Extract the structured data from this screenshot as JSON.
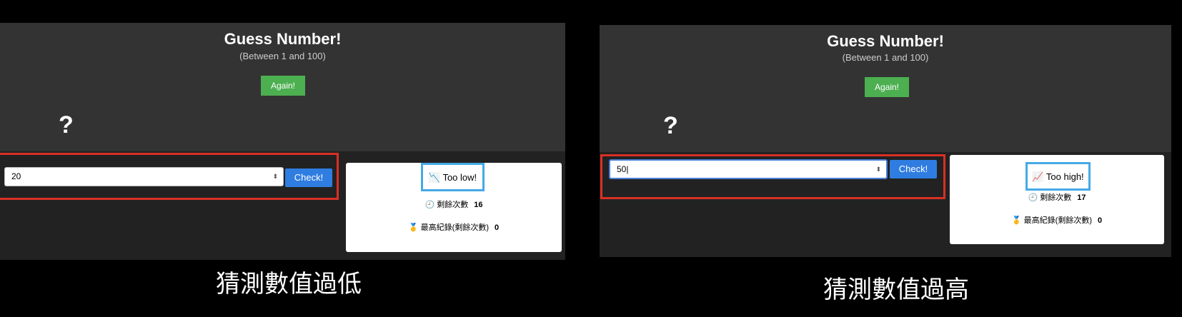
{
  "screens": [
    {
      "title": "Guess Number!",
      "subtitle": "(Between 1 and 100)",
      "again_label": "Again!",
      "mystery": "?",
      "input_value": "20",
      "check_label": "Check!",
      "feedback_icon": "📉",
      "feedback_text": "Too low!",
      "remaining_icon": "🕘",
      "remaining_label": "剩餘次數",
      "remaining_value": "16",
      "record_icon": "🥇",
      "record_label": "最高紀錄(剩餘次數)",
      "record_value": "0",
      "caption": "猜測數值過低"
    },
    {
      "title": "Guess Number!",
      "subtitle": "(Between 1 and 100)",
      "again_label": "Again!",
      "mystery": "?",
      "input_value": "50",
      "check_label": "Check!",
      "feedback_icon": "📈",
      "feedback_text": "Too high!",
      "remaining_icon": "🕘",
      "remaining_label": "剩餘次數",
      "remaining_value": "17",
      "record_icon": "🥇",
      "record_label": "最高紀錄(剩餘次數)",
      "record_value": "0",
      "caption": "猜測數值過高"
    }
  ],
  "colors": {
    "header_bg": "#333333",
    "lower_bg": "#222222",
    "again_button": "#4caf50",
    "check_button": "#2f7de1",
    "highlight_red": "#d93025",
    "highlight_blue": "#45a9e6"
  },
  "icons": {
    "input_spinner": "spinner-arrows-icon"
  }
}
